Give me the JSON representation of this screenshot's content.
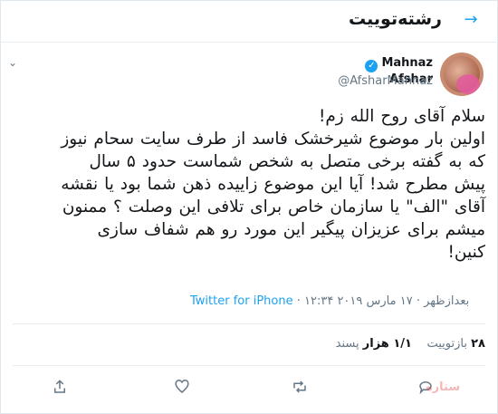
{
  "header": {
    "title": "رشته‌توییت",
    "back_icon": "arrow-right-icon"
  },
  "author": {
    "name": "Mahnaz Afshar",
    "handle": "@AfsharMahnaz",
    "verified": true
  },
  "tweet": {
    "lines": [
      "سلام آقای روح الله زم!",
      "اولین بار موضوع شیرخشک فاسد از طرف سایت سحام نیوز",
      "که به گفته برخی متصل به شخص شماست حدود ۵ سال",
      "پیش مطرح شد! آیا این موضوع زاییده ذهن شما بود یا نقشه",
      "آقای \"الف\" یا سازمان خاص برای تلافی این وصلت ؟ ممنون",
      "میشم برای عزیزان پیگیر این مورد رو هم شفاف سازی",
      "کنین!"
    ]
  },
  "meta": {
    "timestamp": "۱۲:۳۴ بعدازظهر · ۱۷ مارس ۲۰۱۹",
    "separator": " · ",
    "source": "Twitter for iPhone"
  },
  "stats": {
    "retweets_count": "۲۸",
    "retweets_label": "بازتوییت",
    "likes_count": "۱/۱ هزار",
    "likes_label": "پسند"
  },
  "watermark": "ستاره",
  "colors": {
    "accent": "#1da1f2",
    "text": "#14171a",
    "muted": "#657786",
    "border": "#e6ecf0"
  }
}
